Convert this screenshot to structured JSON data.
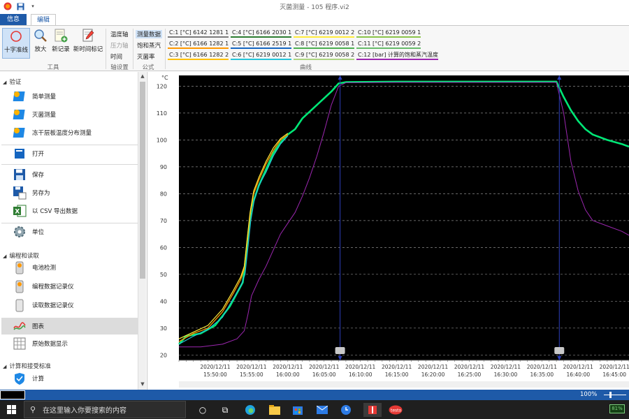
{
  "window": {
    "title": "灭菌测量 - 105 程序.vi2"
  },
  "tabs": {
    "info": "信息",
    "edit": "编辑"
  },
  "ribbon": {
    "tools": {
      "crosshair": "十字准线",
      "zoom": "放大",
      "new_record": "新记录",
      "new_time_marker": "新时间标记",
      "group_label": "工具"
    },
    "axis_settings": {
      "items": [
        "温度轴",
        "压力轴",
        "时间"
      ],
      "group_label": "轴设置"
    },
    "formula": {
      "items": [
        "测量数据",
        "饱和蒸汽",
        "灭菌率"
      ],
      "group_label": "公式"
    },
    "curves": {
      "group_label": "曲线",
      "items": [
        {
          "label": "C:1 [°C] 6142 1281 1",
          "color": "#7a7a7a"
        },
        {
          "label": "C:4 [°C] 6166 2030 1",
          "color": "#2e7d32"
        },
        {
          "label": "C:7 [°C] 6219 0012 2",
          "color": "#ffeb3b"
        },
        {
          "label": "C:10 [°C] 6219 0059 1",
          "color": "#8bc34a"
        },
        {
          "label": "C:2 [°C] 6166 1282 1",
          "color": "#ff9800"
        },
        {
          "label": "C:5 [°C] 6166 2519 1",
          "color": "#1565c0"
        },
        {
          "label": "C:8 [°C] 6219 0058 1",
          "color": "#4caf50"
        },
        {
          "label": "C:11 [°C] 6219 0059 2",
          "color": "#66bb6a"
        },
        {
          "label": "C:3 [°C] 6166 1282 2",
          "color": "#ffc107"
        },
        {
          "label": "C:6 [°C] 6219 0012 1",
          "color": "#26c6da"
        },
        {
          "label": "C:9 [°C] 6219 0058 2",
          "color": "#aed581"
        },
        {
          "label": "C:12 [bar] 计算的饱和蒸汽温度",
          "color": "#9c27b0"
        }
      ]
    }
  },
  "sidebar": {
    "sections": {
      "verify": "验证",
      "program": "编程和读取",
      "calc": "计算和接受标准"
    },
    "items": {
      "simple": "简单测量",
      "sterilize": "灭菌测量",
      "freeze": "冻干层板温度分布测量",
      "open": "打开",
      "save": "保存",
      "saveas": "另存为",
      "csv": "以 CSV 导出数据",
      "unit": "单位",
      "battery": "电池检测",
      "program_logger": "编程数据记录仪",
      "read_logger": "读取数据记录仪",
      "chart": "图表",
      "raw": "原始数据显示",
      "calculate": "计算"
    }
  },
  "statusbar": {
    "zoom": "100%"
  },
  "taskbar": {
    "search_placeholder": "在这里输入你要搜索的内容",
    "battery": "81%"
  },
  "chart_data": {
    "type": "line",
    "ylabel": "°C",
    "ylim": [
      18,
      124
    ],
    "yticks": [
      20,
      30,
      40,
      50,
      60,
      70,
      80,
      90,
      100,
      110,
      120
    ],
    "x_unit": "minutes",
    "xlim": [
      0,
      62
    ],
    "xticks": [
      {
        "x": 5,
        "date": "2020/12/11",
        "time": "15:50:00"
      },
      {
        "x": 10,
        "date": "2020/12/11",
        "time": "15:55:00"
      },
      {
        "x": 15,
        "date": "2020/12/11",
        "time": "16:00:00"
      },
      {
        "x": 20,
        "date": "2020/12/11",
        "time": "16:05:00"
      },
      {
        "x": 25,
        "date": "2020/12/11",
        "time": "16:10:00"
      },
      {
        "x": 30,
        "date": "2020/12/11",
        "time": "16:15:00"
      },
      {
        "x": 35,
        "date": "2020/12/11",
        "time": "16:20:00"
      },
      {
        "x": 40,
        "date": "2020/12/11",
        "time": "16:25:00"
      },
      {
        "x": 45,
        "date": "2020/12/11",
        "time": "16:30:00"
      },
      {
        "x": 50,
        "date": "2020/12/11",
        "time": "16:35:00"
      },
      {
        "x": 55,
        "date": "2020/12/11",
        "time": "16:40:00"
      },
      {
        "x": 60,
        "date": "2020/12/11",
        "time": "16:45:00"
      }
    ],
    "markers_x": [
      22.2,
      52.4
    ],
    "grid": true,
    "background": "#000000",
    "series": [
      {
        "color": "#00e676",
        "width": 2.6,
        "points": [
          [
            0,
            24
          ],
          [
            1,
            27
          ],
          [
            3,
            28
          ],
          [
            5,
            31
          ],
          [
            7,
            38
          ],
          [
            8,
            43
          ],
          [
            8.8,
            47
          ],
          [
            9.2,
            56
          ],
          [
            9.6,
            66
          ],
          [
            10,
            75
          ],
          [
            11,
            83
          ],
          [
            12,
            89
          ],
          [
            13,
            95
          ],
          [
            14,
            99
          ],
          [
            15,
            102
          ],
          [
            16,
            104
          ],
          [
            17,
            108
          ],
          [
            19,
            113
          ],
          [
            21,
            118
          ],
          [
            22,
            121
          ],
          [
            23,
            121.5
          ],
          [
            30,
            121.7
          ],
          [
            40,
            121.7
          ],
          [
            52,
            121.7
          ],
          [
            53,
            116
          ],
          [
            54,
            111
          ],
          [
            55,
            107
          ],
          [
            56,
            104
          ],
          [
            57,
            102
          ],
          [
            59,
            100
          ],
          [
            61,
            98.5
          ],
          [
            62,
            97.5
          ]
        ]
      },
      {
        "color": "#ff9800",
        "width": 1.3,
        "points": [
          [
            0,
            25
          ],
          [
            2,
            28
          ],
          [
            4,
            30
          ],
          [
            6,
            36
          ],
          [
            7.5,
            43
          ],
          [
            8.5,
            48
          ],
          [
            9,
            52
          ],
          [
            9.4,
            62
          ],
          [
            9.8,
            72
          ],
          [
            10.3,
            80
          ],
          [
            11,
            85
          ],
          [
            12,
            91
          ],
          [
            13,
            96
          ],
          [
            14,
            100
          ],
          [
            15,
            102
          ]
        ]
      },
      {
        "color": "#ffeb3b",
        "width": 1.2,
        "points": [
          [
            0,
            26
          ],
          [
            2,
            28.5
          ],
          [
            4,
            31
          ],
          [
            6,
            37
          ],
          [
            7.5,
            44
          ],
          [
            8.5,
            49
          ],
          [
            9,
            53
          ],
          [
            9.4,
            63
          ],
          [
            9.8,
            73
          ],
          [
            10.3,
            81
          ],
          [
            11,
            86
          ],
          [
            12,
            92
          ],
          [
            13,
            97
          ],
          [
            14,
            100.5
          ],
          [
            15,
            102.5
          ]
        ]
      },
      {
        "color": "#26c6da",
        "width": 1.2,
        "points": [
          [
            0,
            24
          ],
          [
            2,
            27
          ],
          [
            4,
            29.5
          ],
          [
            6,
            34
          ],
          [
            7.5,
            41
          ],
          [
            8.6,
            46
          ],
          [
            9.1,
            50
          ],
          [
            9.5,
            60
          ],
          [
            9.9,
            70
          ],
          [
            10.4,
            78
          ],
          [
            11,
            83
          ],
          [
            12,
            88
          ],
          [
            13,
            94
          ],
          [
            14,
            98.5
          ],
          [
            15,
            101.5
          ]
        ]
      },
      {
        "color": "#9c27b0",
        "width": 1.0,
        "points": [
          [
            0,
            23
          ],
          [
            3,
            23
          ],
          [
            6,
            24
          ],
          [
            8,
            26
          ],
          [
            9,
            29
          ],
          [
            9.5,
            35
          ],
          [
            10,
            42
          ],
          [
            11,
            48
          ],
          [
            12,
            53
          ],
          [
            13,
            59
          ],
          [
            14,
            65
          ],
          [
            15,
            69
          ],
          [
            16,
            73
          ],
          [
            17,
            79
          ],
          [
            18,
            86
          ],
          [
            19,
            94
          ],
          [
            20,
            103
          ],
          [
            21,
            113
          ],
          [
            22,
            120
          ],
          [
            23,
            121.3
          ],
          [
            30,
            121.4
          ],
          [
            52,
            121.4
          ],
          [
            53,
            110
          ],
          [
            54,
            92
          ],
          [
            55,
            81
          ],
          [
            56,
            74
          ],
          [
            57,
            70
          ],
          [
            59,
            68
          ],
          [
            61,
            66
          ],
          [
            62,
            64.5
          ]
        ]
      }
    ]
  }
}
